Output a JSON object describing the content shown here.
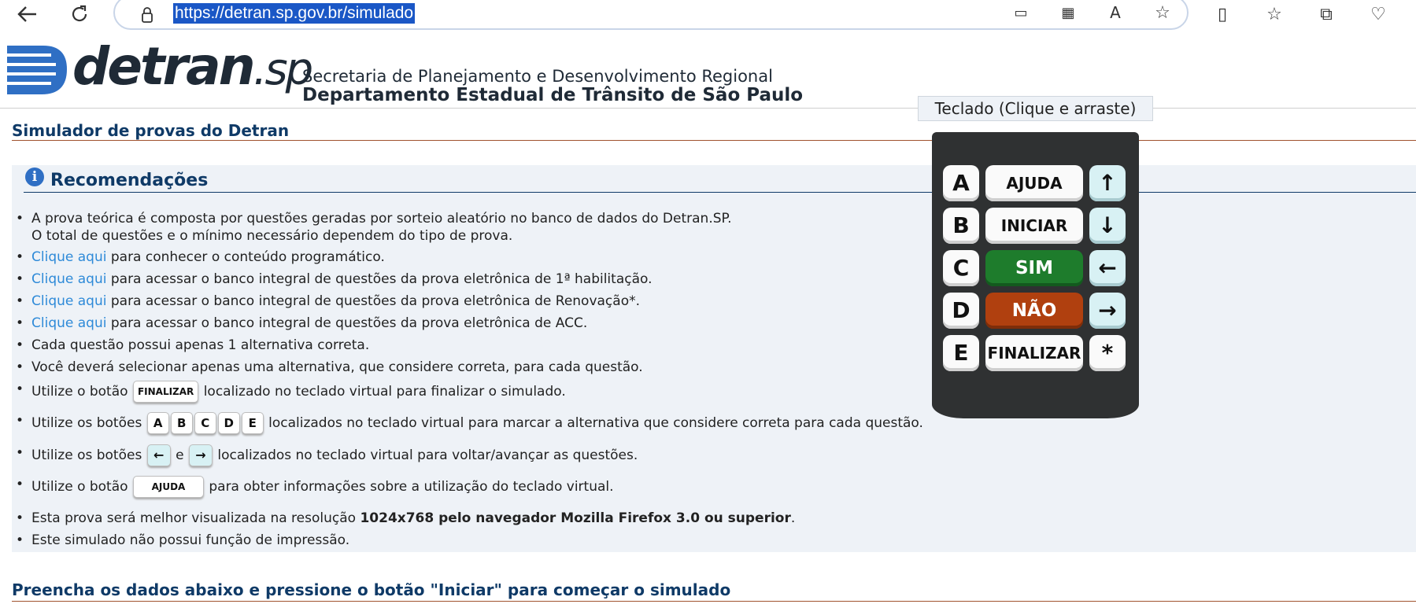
{
  "browser": {
    "url": "https://detran.sp.gov.br/simulado"
  },
  "header": {
    "logo_main": "detran",
    "logo_suffix": ".sp",
    "line1": "Secretaria de Planejamento e Desenvolvimento Regional",
    "line2": "Departamento Estadual de Trânsito de São Paulo"
  },
  "page": {
    "section_title": "Simulador de provas do Detran",
    "recommendations_title": "Recomendações",
    "bottom_title": "Preencha os dados abaixo e pressione o botão \"Iniciar\" para começar o simulado"
  },
  "recommendations": {
    "item1_line1": "A prova teórica é composta por questões geradas por sorteio aleatório no banco de dados do Detran.SP.",
    "item1_line2": "O total de questões e o mínimo necessário dependem do tipo de prova.",
    "link_label": "Clique aqui",
    "item2_rest": " para conhecer o conteúdo programático.",
    "item3_rest": " para acessar o banco integral de questões da prova eletrônica de 1ª habilitação.",
    "item4_rest": " para acessar o banco integral de questões da prova eletrônica de Renovação*.",
    "item5_rest": " para acessar o banco integral de questões da prova eletrônica de ACC.",
    "item6": "Cada questão possui apenas 1 alternativa correta.",
    "item7": "Você deverá selecionar apenas uma alternativa, que considere correta, para cada questão.",
    "item8_pre": "Utilize o botão ",
    "item8_post": " localizado no teclado virtual para finalizar o simulado.",
    "item9_pre": "Utilize os botões ",
    "item9_post": " localizados no teclado virtual para marcar a alternativa que considere correta para cada questão.",
    "item10_pre": "Utilize os botões ",
    "item10_mid": "e",
    "item10_post": " localizados no teclado virtual para voltar/avançar as questões.",
    "item11_pre": "Utilize o botão ",
    "item11_post": " para obter informações sobre a utilização do teclado virtual.",
    "item12_pre": "Esta prova será melhor visualizada na resolução ",
    "item12_bold": "1024x768 pelo navegador Mozilla Firefox 3.0 ou superior",
    "item12_post": ".",
    "item13": "Este simulado não possui função de impressão."
  },
  "keyboard": {
    "title": "Teclado (Clique e arraste)",
    "letters": [
      "A",
      "B",
      "C",
      "D",
      "E"
    ],
    "ajuda": "AJUDA",
    "iniciar": "INICIAR",
    "sim": "SIM",
    "nao": "NÃO",
    "finalizar": "FINALIZAR",
    "arrows": [
      "↑",
      "↓",
      "←",
      "→",
      "*"
    ]
  },
  "mini_keys": {
    "finalizar": "FINALIZAR",
    "ajuda": "AJUDA",
    "letters": [
      "A",
      "B",
      "C",
      "D",
      "E"
    ],
    "left": "←",
    "right": "→"
  }
}
